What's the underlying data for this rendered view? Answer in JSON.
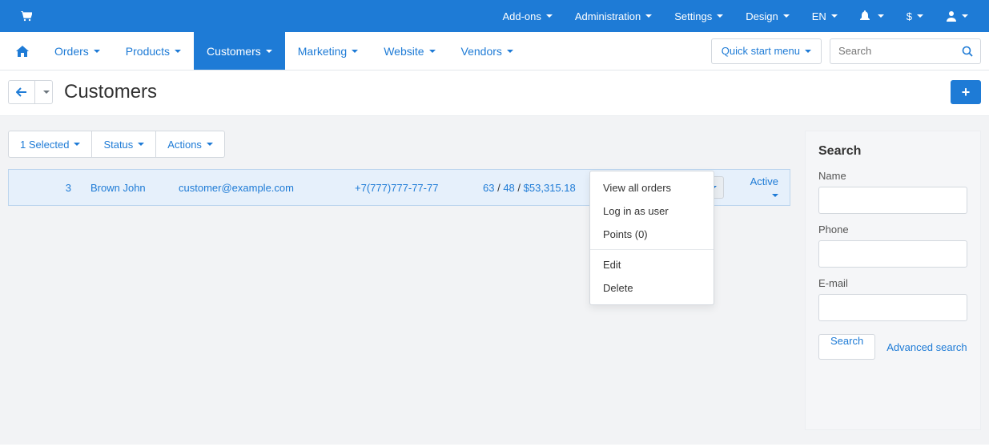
{
  "topbar": {
    "items": [
      {
        "label": "Add-ons"
      },
      {
        "label": "Administration"
      },
      {
        "label": "Settings"
      },
      {
        "label": "Design"
      },
      {
        "label": "EN"
      }
    ],
    "currency": "$"
  },
  "mainnav": {
    "items": [
      {
        "label": "Orders"
      },
      {
        "label": "Products"
      },
      {
        "label": "Customers",
        "active": true
      },
      {
        "label": "Marketing"
      },
      {
        "label": "Website"
      },
      {
        "label": "Vendors"
      }
    ],
    "quick_start_label": "Quick start menu",
    "search_placeholder": "Search"
  },
  "page": {
    "title": "Customers"
  },
  "filters": {
    "selected_label": "1 Selected",
    "status_label": "Status",
    "actions_label": "Actions"
  },
  "row": {
    "id": "3",
    "name": "Brown John",
    "email": "customer@example.com",
    "phone": "+7(777)777-77-77",
    "stat1": "63",
    "stat2": "48",
    "amount": "$53,315.18",
    "status": "Active"
  },
  "dropdown": {
    "view_all_orders": "View all orders",
    "log_in_as_user": "Log in as user",
    "points": "Points (0)",
    "edit": "Edit",
    "delete": "Delete"
  },
  "search_panel": {
    "title": "Search",
    "name_label": "Name",
    "phone_label": "Phone",
    "email_label": "E-mail",
    "search_button": "Search",
    "advanced_link": "Advanced search"
  }
}
